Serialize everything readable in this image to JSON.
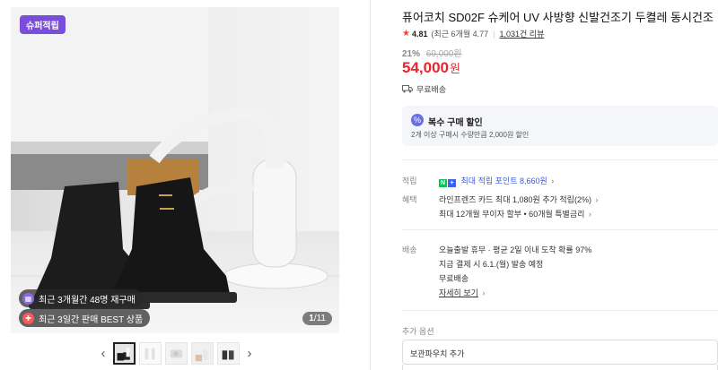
{
  "gallery": {
    "badge": "슈퍼적립",
    "pills": [
      {
        "icon": "calendar-icon",
        "color": "#8a67e8",
        "text": "최근 3개월간 48명 재구매"
      },
      {
        "icon": "gift-icon",
        "color": "#f15c5c",
        "text": "최근 3일간 판매 BEST 상품"
      }
    ],
    "counter_current": "1",
    "counter_total": "/11",
    "prev_label": "‹",
    "next_label": "›"
  },
  "product": {
    "title": "퓨어코치 SD02F 슈케어 UV 사방향 신발건조기 두켤레 동시건조",
    "rating": "4.81",
    "rating_note": "(최근 6개월 4.77",
    "reviews": "1,031건 리뷰",
    "discount_rate": "21%",
    "original_price": "69,000원",
    "price": "54,000",
    "currency": "원",
    "shipping": "무료배송"
  },
  "promo": {
    "title": "복수 구매 할인",
    "desc": "2개 이상 구매시 수량만큼 2,000원 할인"
  },
  "benefits": {
    "points_label": "적립",
    "points_text": "최대 적립 포인트 8,660원",
    "card_label": "혜택",
    "card_line1": "라인프렌즈 카드 최대 1,080원 추가 적립(2%)",
    "card_line2": "최대 12개월 무이자 할부 • 60개월 특별금리"
  },
  "delivery": {
    "label": "배송",
    "line1": "오늘출발 휴무 · 평균 2일 이내 도착 확률 97%",
    "line2": "지금 결제 시 6.1.(월) 발송 예정",
    "line3": "무료배송",
    "detail": "자세히 보기"
  },
  "options": {
    "label": "추가 옵션",
    "selected": "보관파우치 추가"
  },
  "colors": {
    "accent": "#7a4ddb",
    "price_red": "#e8262f",
    "link_blue": "#3b5bdb",
    "npay_green": "#03c75a"
  }
}
